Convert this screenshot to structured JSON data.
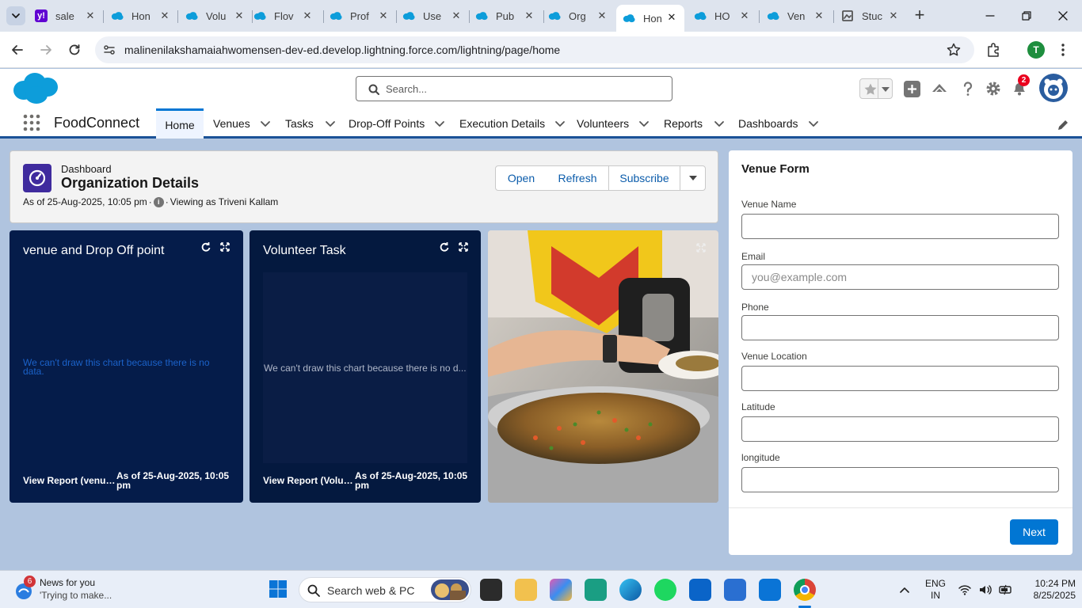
{
  "browser": {
    "tabs": [
      {
        "label": "sale",
        "icon": "yahoo-icon"
      },
      {
        "label": "Hon",
        "icon": "salesforce-cloud-icon"
      },
      {
        "label": "Volu",
        "icon": "salesforce-cloud-icon"
      },
      {
        "label": "Flov",
        "icon": "salesforce-cloud-icon"
      },
      {
        "label": "Prof",
        "icon": "salesforce-cloud-icon"
      },
      {
        "label": "Use",
        "icon": "salesforce-cloud-icon"
      },
      {
        "label": "Pub",
        "icon": "salesforce-cloud-icon"
      },
      {
        "label": "Org",
        "icon": "salesforce-cloud-icon"
      },
      {
        "label": "Hon",
        "icon": "salesforce-cloud-icon",
        "active": true
      },
      {
        "label": "HO",
        "icon": "salesforce-cloud-icon"
      },
      {
        "label": "Ven",
        "icon": "salesforce-cloud-icon"
      },
      {
        "label": "Stuc",
        "icon": "page-icon"
      }
    ],
    "url": "malinenilakshamaiahwomensen-dev-ed.develop.lightning.force.com/lightning/page/home",
    "profile_initial": "T"
  },
  "sf": {
    "search_placeholder": "Search...",
    "notifications_count": "2",
    "app_name": "FoodConnect",
    "nav": [
      {
        "label": "Home",
        "active": true,
        "dropdown": false
      },
      {
        "label": "Venues",
        "dropdown": true
      },
      {
        "label": "Tasks",
        "dropdown": true
      },
      {
        "label": "Drop-Off Points",
        "dropdown": true
      },
      {
        "label": "Execution Details",
        "dropdown": true
      },
      {
        "label": "Volunteers",
        "dropdown": true
      },
      {
        "label": "Reports",
        "dropdown": true
      },
      {
        "label": "Dashboards",
        "dropdown": true
      }
    ]
  },
  "dashboard": {
    "type_label": "Dashboard",
    "title": "Organization Details",
    "as_of": "As of 25-Aug-2025, 10:05 pm",
    "viewing_as": "Viewing as Triveni Kallam",
    "buttons": {
      "open": "Open",
      "refresh": "Refresh",
      "subscribe": "Subscribe"
    }
  },
  "widgets": [
    {
      "title": "venue and Drop Off point",
      "empty_message": "We can't draw this chart because there is no data.",
      "view_report": "View Report (venue...",
      "as_of": "As of 25-Aug-2025, 10:05 pm"
    },
    {
      "title": "Volunteer Task",
      "empty_message": "We can't draw this chart because there is no d...",
      "view_report": "View Report (Volun...",
      "as_of": "As of 25-Aug-2025, 10:05 pm"
    }
  ],
  "venue_form": {
    "title": "Venue Form",
    "fields": [
      {
        "label": "Venue Name",
        "placeholder": ""
      },
      {
        "label": "Email",
        "placeholder": "you@example.com"
      },
      {
        "label": "Phone",
        "placeholder": ""
      },
      {
        "label": "Venue Location",
        "placeholder": ""
      },
      {
        "label": "Latitude",
        "placeholder": ""
      },
      {
        "label": "longitude",
        "placeholder": ""
      }
    ],
    "next_label": "Next"
  },
  "taskbar": {
    "news_badge": "6",
    "news_title": "News for you",
    "news_sub": "'Trying to make...",
    "search_placeholder": "Search web & PC",
    "lang": "ENG",
    "region": "IN",
    "time": "10:24 PM",
    "date": "8/25/2025"
  },
  "colors": {
    "brand_blue": "#0176d3",
    "button_text": "#0b5cab",
    "widget_bg": "#051c4a",
    "page_bg": "#b0c4df",
    "notification_red": "#ea001e"
  }
}
